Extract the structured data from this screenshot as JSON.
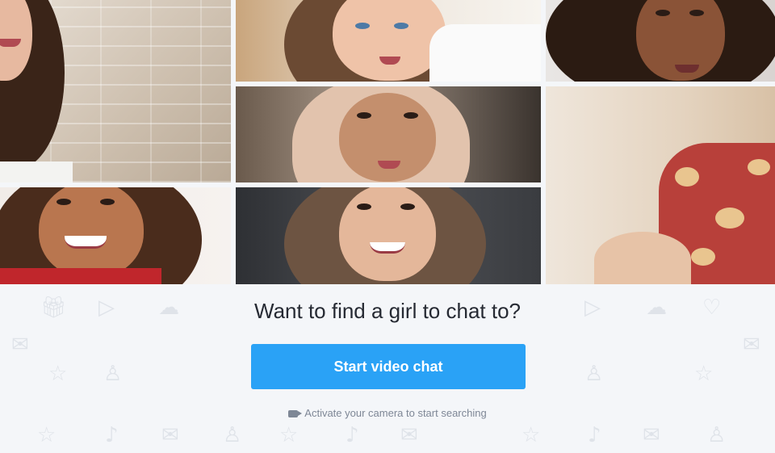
{
  "photos": [
    {
      "id": "t1",
      "subject": "woman-smiling-brick-wall"
    },
    {
      "id": "t2",
      "subject": "woman-blue-eyes"
    },
    {
      "id": "t3",
      "subject": "woman-curly-hair"
    },
    {
      "id": "t4",
      "subject": "woman-hijab"
    },
    {
      "id": "t5",
      "subject": "woman-red-floral-dress"
    },
    {
      "id": "t6",
      "subject": "woman-smiling-red-top"
    },
    {
      "id": "t7",
      "subject": "woman-smiling-dark-background"
    }
  ],
  "hero": {
    "headline": "Want to find a girl to chat to?",
    "cta_label": "Start video chat",
    "hint": "Activate your camera to start searching"
  },
  "colors": {
    "cta": "#2aa2f6",
    "panel_bg": "#f4f6f9",
    "headline": "#262a33",
    "hint": "#7e8796"
  },
  "icons": [
    "video-camera-icon",
    "gift-icon",
    "play-icon",
    "cloud-icon",
    "heart-icon",
    "chat-bubble-icon",
    "mic-icon",
    "star-icon",
    "envelope-icon",
    "user-icon"
  ]
}
